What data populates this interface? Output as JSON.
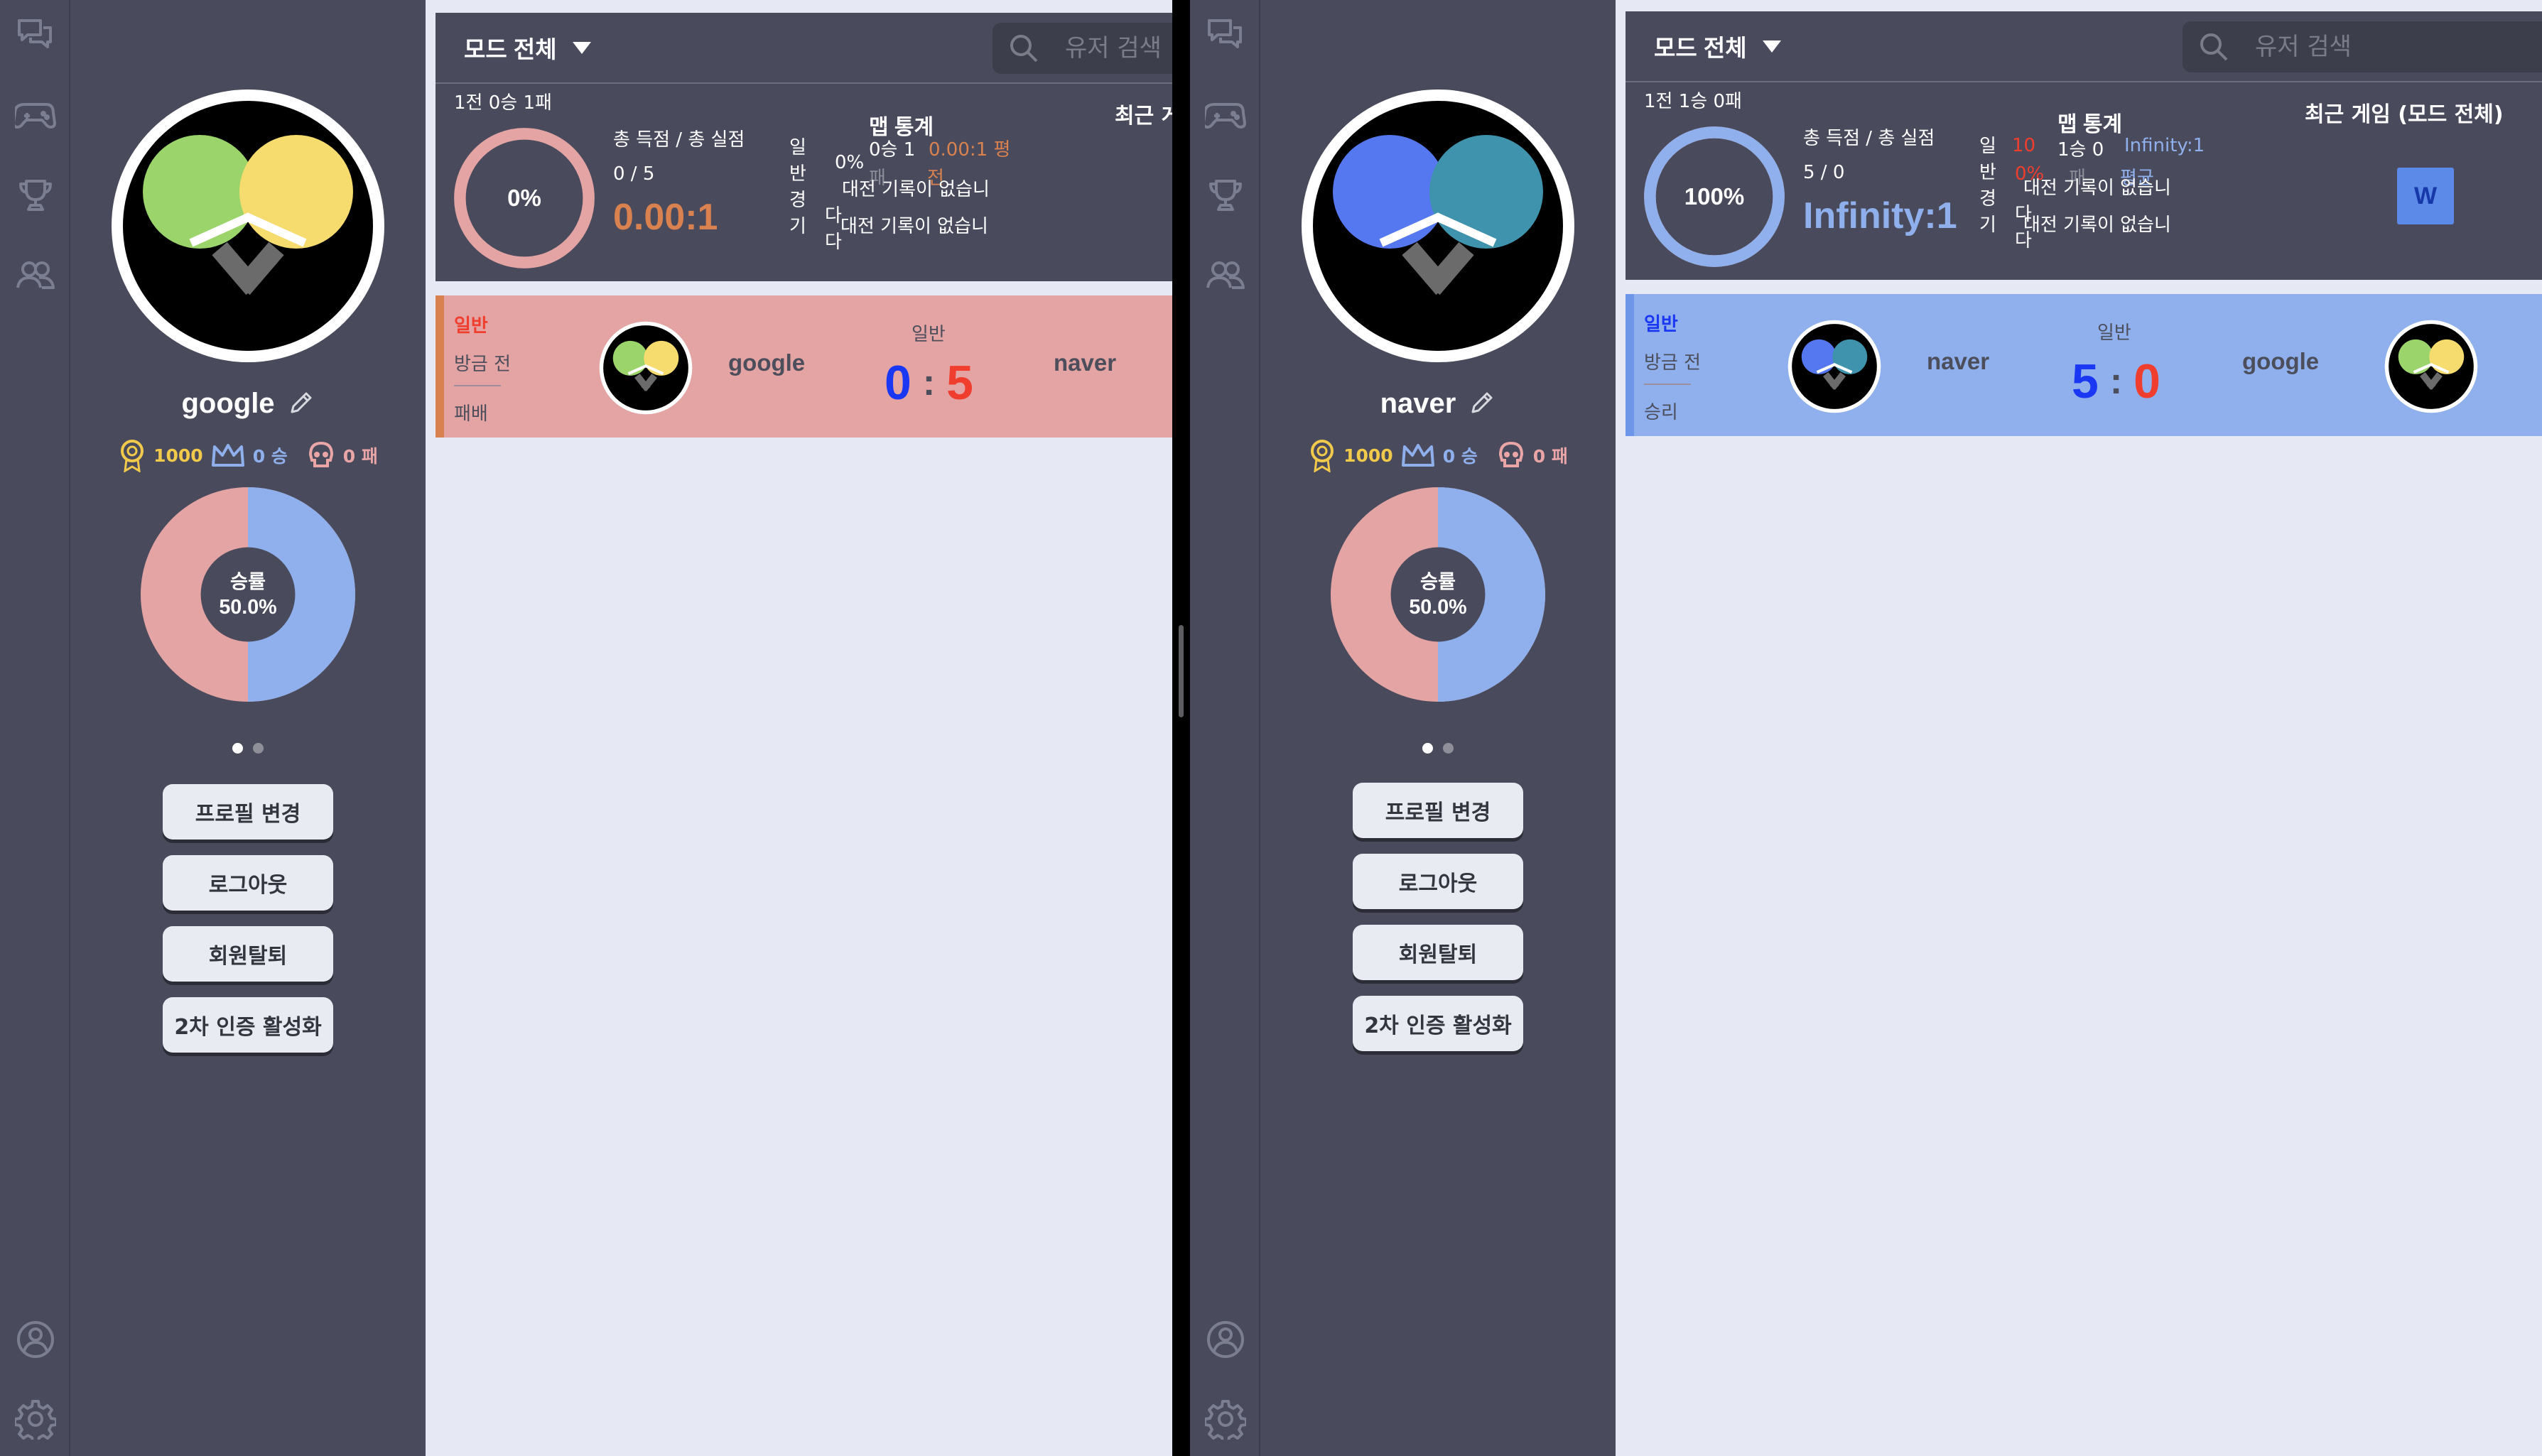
{
  "colors": {
    "sidebar_bg": "#494b5c",
    "content_bg": "#e6e9f3",
    "win_blue": "#8fb0ec",
    "loss_pink": "#e4a4a4",
    "gold": "#f1c94b",
    "orange": "#d9814f",
    "score_blue": "#1a37f3",
    "score_red": "#f03e2e"
  },
  "icons": {
    "nav": [
      "chat-icon",
      "gamepad-icon",
      "trophy-icon",
      "friends-icon"
    ],
    "bottom": [
      "profile-icon",
      "settings-icon"
    ]
  },
  "left": {
    "user": {
      "name": "google",
      "rating": "1000",
      "wins": "0 승",
      "losses": "0 패",
      "winrate_label": "승률",
      "winrate_value": "50.0%",
      "winrate_fraction": 0.5
    },
    "buttons": {
      "edit_profile": "프로필 변경",
      "logout": "로그아웃",
      "withdraw": "회원탈퇴",
      "twofa": "2차 인증 활성화"
    },
    "topbar": {
      "mode": "모드 전체",
      "search_placeholder": "유저 검색"
    },
    "stats": {
      "record": "1전 0승 1패",
      "win_percent": "0%",
      "win_fraction": 0,
      "points_label": "총 득점 / 총 실점",
      "points_value": "0 / 5",
      "ratio": "0.00:1",
      "vertical_1": [
        "일",
        "반",
        "경",
        "기"
      ],
      "vertical_2": [
        "다",
        "다"
      ],
      "map_title": "맵 통계",
      "map_line1_a": "0승 1",
      "map_line1_b": "0.00:1 평",
      "map_line2_pct": "0%",
      "map_line2_b": "패",
      "map_line2_c": "전",
      "no_record_1": "대전 기록이 없습니",
      "no_record_2": "대전 기록이 없습니",
      "recent_title": "최근 게"
    },
    "match": {
      "mode": "일반",
      "time": "방금 전",
      "result": "패배",
      "player1": "google",
      "player2": "naver",
      "game_mode": "일반",
      "score1": "0",
      "score2": "5",
      "colon": ":"
    }
  },
  "right": {
    "user": {
      "name": "naver",
      "rating": "1000",
      "wins": "0 승",
      "losses": "0 패",
      "winrate_label": "승률",
      "winrate_value": "50.0%",
      "winrate_fraction": 0.5
    },
    "buttons": {
      "edit_profile": "프로필 변경",
      "logout": "로그아웃",
      "withdraw": "회원탈퇴",
      "twofa": "2차 인증 활성화"
    },
    "topbar": {
      "mode": "모드 전체",
      "search_placeholder": "유저 검색"
    },
    "stats": {
      "record": "1전 1승 0패",
      "win_percent": "100%",
      "win_fraction": 1,
      "points_label": "총 득점 / 총 실점",
      "points_value": "5 / 0",
      "ratio": "Infinity:1",
      "vertical_1": [
        "일",
        "반",
        "경",
        "기"
      ],
      "vertical_2": [
        "다",
        "다"
      ],
      "map_title": "맵 통계",
      "map_line1_a": "10",
      "map_line1_b": "1승 0",
      "map_line1_c": "Infinity:1",
      "map_line2_pct": "0%",
      "map_line2_b": "패",
      "map_line2_c": "평균",
      "no_record_1": "대전 기록이 없습니",
      "no_record_2": "대전 기록이 없습니",
      "recent_title": "최근 게임 (모드 전체)",
      "recent_badge": "W"
    },
    "match": {
      "mode": "일반",
      "time": "방금 전",
      "result": "승리",
      "player1": "naver",
      "player2": "google",
      "game_mode": "일반",
      "score1": "5",
      "score2": "0",
      "colon": ":"
    }
  }
}
